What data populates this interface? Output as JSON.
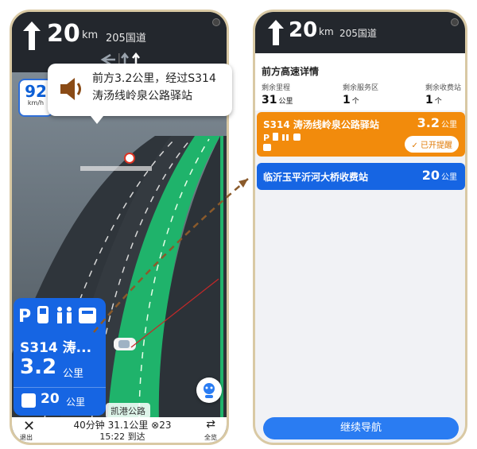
{
  "left": {
    "nav": {
      "distance": "20",
      "distance_unit": "km",
      "road": "205国道"
    },
    "speed": {
      "value": "92",
      "unit": "km/h"
    },
    "bubble": {
      "text": "前方3.2公里，经过S314涛汤线岭泉公路驿站"
    },
    "poi": {
      "name": "S314 涛...",
      "distance": "3.2",
      "distance_unit": "公里",
      "toll_distance": "20",
      "toll_unit": "公里"
    },
    "road_label": "凯港公路",
    "bottom": {
      "exit_label": "退出",
      "stats": "40分钟  31.1公里  ⊗23",
      "arrive": "15:22 到达",
      "full_label": "全览"
    }
  },
  "right": {
    "nav": {
      "distance": "20",
      "distance_unit": "km",
      "road": "205国道"
    },
    "panel_title": "前方高速详情",
    "stats": [
      {
        "label": "剩余里程",
        "value": "31",
        "unit": "公里"
      },
      {
        "label": "剩余服务区",
        "value": "1",
        "unit": "个"
      },
      {
        "label": "剩余收费站",
        "value": "1",
        "unit": "个"
      }
    ],
    "service": {
      "name": "S314 涛汤线岭泉公路驿站",
      "distance": "3.2",
      "unit": "公里",
      "remind": "✓ 已开提醒"
    },
    "toll": {
      "name": "临沂玉平沂河大桥收费站",
      "distance": "20",
      "unit": "公里"
    },
    "continue_label": "继续导航"
  },
  "colors": {
    "accent_blue": "#1665e3",
    "orange": "#f28b0c",
    "route_green": "#1fb36b"
  }
}
